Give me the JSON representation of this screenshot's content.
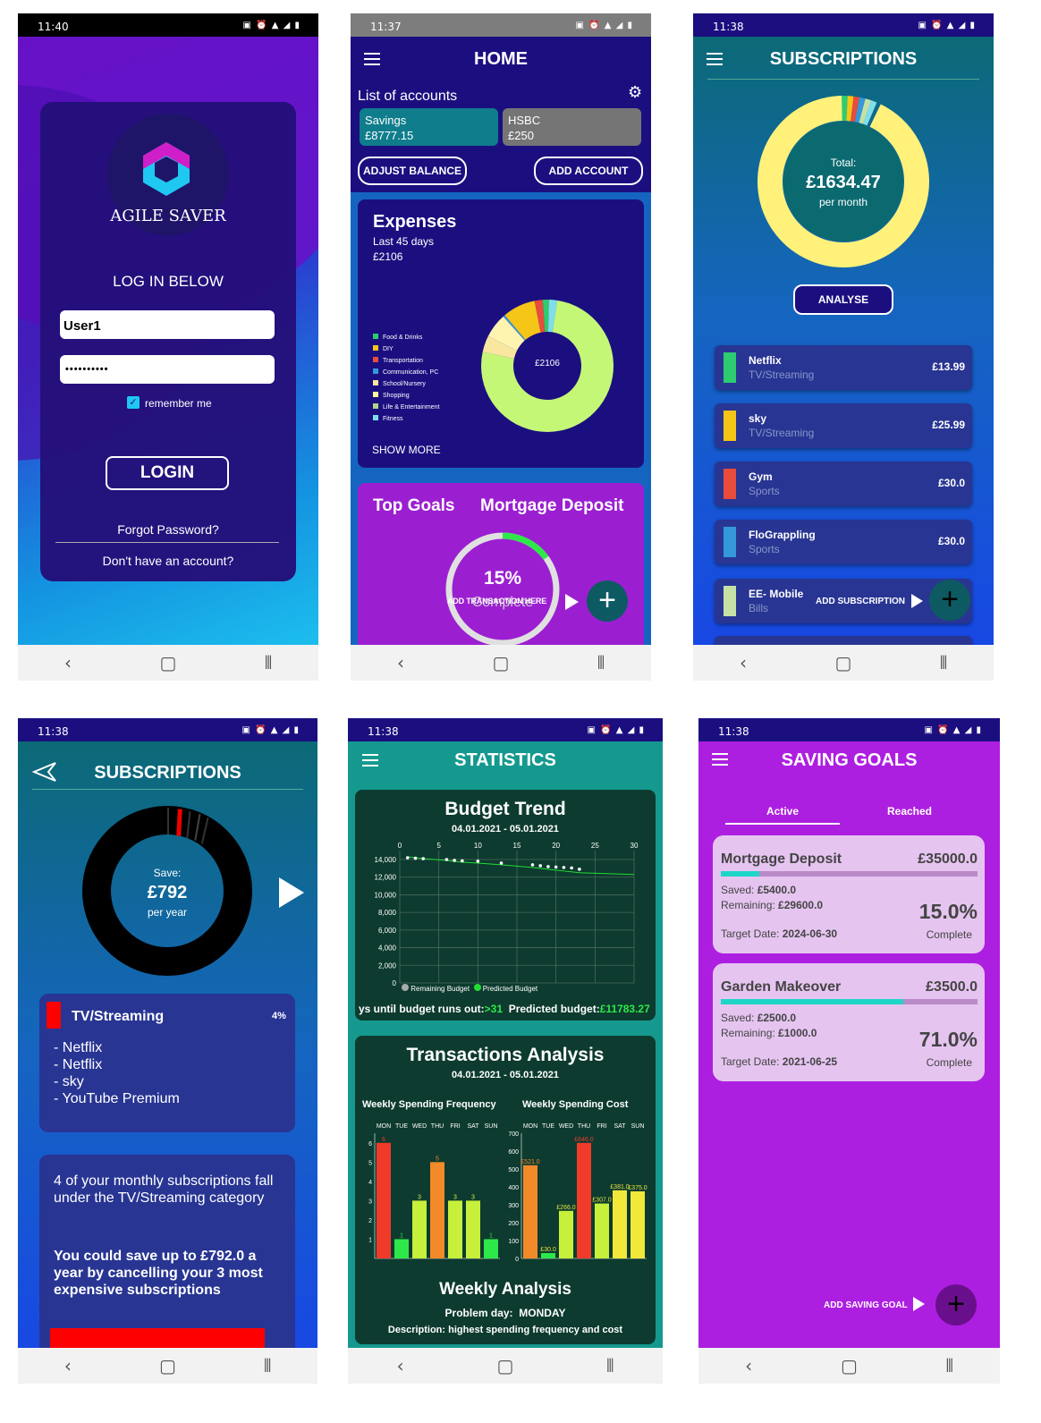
{
  "login": {
    "time": "11:40",
    "title": "AGILE SAVER",
    "subtitle": "LOG IN BELOW",
    "username": "User1",
    "password": "••••••••••",
    "remember": "remember me",
    "login_btn": "LOGIN",
    "forgot": "Forgot Password?",
    "signup": "Don't have an account?"
  },
  "home": {
    "time": "11:37",
    "title": "HOME",
    "accounts_label": "List of accounts",
    "accounts": [
      {
        "name": "Savings",
        "balance": "£8777.15"
      },
      {
        "name": "HSBC",
        "balance": "£250"
      }
    ],
    "adjust_btn": "ADJUST BALANCE",
    "add_account_btn": "ADD ACCOUNT",
    "expenses": {
      "title": "Expenses",
      "period": "Last 45 days",
      "total": "£2106",
      "center": "£2106",
      "legend": [
        "Food & Drinks",
        "DIY",
        "Transportation",
        "Communication, PC",
        "School/Nursery",
        "Shopping",
        "Life & Entertainment",
        "Fitness"
      ],
      "legend_colors": [
        "#2ecc71",
        "#f5c518",
        "#e74c3c",
        "#3498db",
        "#f9e79f",
        "#fff59d",
        "#aed581",
        "#80deea"
      ],
      "show_more": "SHOW MORE"
    },
    "goals": {
      "title": "Top Goals",
      "goal": "Mortgage Deposit",
      "percent": "15%",
      "complete": "Complete",
      "add_tx": "ADD TRANSACTION HERE",
      "progress": 0.15
    }
  },
  "subs": {
    "time": "11:38",
    "title": "SUBSCRIPTIONS",
    "total_label": "Total:",
    "total": "£1634.47",
    "per": "per month",
    "analyse_btn": "ANALYSE",
    "items": [
      {
        "name": "Netflix",
        "cat": "TV/Streaming",
        "price": "£13.99",
        "color": "#2ecc71"
      },
      {
        "name": "sky",
        "cat": "TV/Streaming",
        "price": "£25.99",
        "color": "#f5c518"
      },
      {
        "name": "Gym",
        "cat": "Sports",
        "price": "£30.0",
        "color": "#e74c3c"
      },
      {
        "name": "FloGrappling",
        "cat": "Sports",
        "price": "£30.0",
        "color": "#3498db"
      },
      {
        "name": "EE- Mobile",
        "cat": "Bills",
        "price": "",
        "color": "#c5e1a5"
      }
    ],
    "add_sub": "ADD SUBSCRIPTION"
  },
  "analyse": {
    "time": "11:38",
    "title": "SUBSCRIPTIONS",
    "save_label": "Save:",
    "save": "£792",
    "per": "per year",
    "category": "TV/Streaming",
    "percent": "4%",
    "list": [
      "- Netflix",
      "- Netflix",
      "- sky",
      "- YouTube Premium"
    ],
    "info": "4 of your monthly subscriptions fall under the TV/Streaming category",
    "tip": "You could save up to £792.0 a year by cancelling your 3 most expensive subscriptions"
  },
  "stats": {
    "time": "11:38",
    "title": "STATISTICS",
    "trend_title": "Budget Trend",
    "date_range": "04.01.2021 - 05.01.2021",
    "x_ticks": [
      "0",
      "5",
      "10",
      "15",
      "20",
      "25",
      "30"
    ],
    "y_ticks": [
      "14,000",
      "12,000",
      "10,000",
      "8,000",
      "6,000",
      "4,000",
      "2,000",
      "0"
    ],
    "legend_remaining": "Remaining Budget",
    "legend_predicted": "Predicted Budget",
    "days_label": "ys until budget runs out:",
    "days_value": ">31",
    "predicted_label": "Predicted budget:",
    "predicted_value": "£11783.27",
    "tx_title": "Transactions Analysis",
    "freq_title": "Weekly Spending Frequency",
    "cost_title": "Weekly Spending Cost",
    "days": [
      "MON",
      "TUE",
      "WED",
      "THU",
      "FRI",
      "SAT",
      "SUN"
    ],
    "freq_y": [
      "6",
      "5",
      "4",
      "3",
      "2",
      "1"
    ],
    "cost_y": [
      "700",
      "600",
      "500",
      "400",
      "300",
      "200",
      "100",
      "0"
    ],
    "weekly_title": "Weekly Analysis",
    "problem_label": "Problem day:",
    "problem_day": "MONDAY",
    "description": "Description: highest spending frequency and cost"
  },
  "goals": {
    "time": "11:38",
    "title": "SAVING GOALS",
    "tab_active": "Active",
    "tab_reached": "Reached",
    "items": [
      {
        "name": "Mortgage Deposit",
        "target": "£35000.0",
        "saved": "£5400.0",
        "remaining": "£29600.0",
        "percent": "15.0%",
        "date": "2024-06-30",
        "progress": 0.15
      },
      {
        "name": "Garden Makeover",
        "target": "£3500.0",
        "saved": "£2500.0",
        "remaining": "£1000.0",
        "percent": "71.0%",
        "date": "2021-06-25",
        "progress": 0.71
      }
    ],
    "saved_label": "Saved:",
    "remaining_label": "Remaining:",
    "target_label": "Target Date:",
    "complete": "Complete",
    "add_goal": "ADD SAVING GOAL"
  },
  "chart_data": [
    {
      "type": "pie",
      "title": "Expenses",
      "categories": [
        "Food & Drinks",
        "DIY",
        "Transportation",
        "Communication, PC",
        "School/Nursery",
        "Shopping",
        "Life & Entertainment",
        "Fitness"
      ],
      "values": [
        1.5,
        8,
        2,
        0.5,
        4,
        6,
        76,
        2
      ]
    },
    {
      "type": "line",
      "title": "Budget Trend",
      "x": [
        1,
        2,
        3,
        6,
        7,
        8,
        10,
        13,
        17,
        18,
        19,
        20,
        21,
        22,
        23
      ],
      "series": [
        {
          "name": "Remaining Budget",
          "values": [
            14200,
            14150,
            14100,
            14000,
            13900,
            13850,
            13800,
            13600,
            13400,
            13300,
            13200,
            13150,
            13100,
            13050,
            12900
          ]
        },
        {
          "name": "Predicted Budget",
          "values": [
            14300,
            14200,
            14100,
            13900,
            13800,
            13700,
            13600,
            13400,
            13100,
            13000,
            12900,
            12800,
            12700,
            12600,
            12500
          ]
        }
      ],
      "xlim": [
        0,
        30
      ],
      "ylim": [
        0,
        14000
      ]
    },
    {
      "type": "bar",
      "title": "Weekly Spending Frequency",
      "categories": [
        "MON",
        "TUE",
        "WED",
        "THU",
        "FRI",
        "SAT",
        "SUN"
      ],
      "values": [
        6,
        1,
        3,
        5,
        3,
        3,
        1
      ],
      "ylim": [
        0,
        6.5
      ]
    },
    {
      "type": "bar",
      "title": "Weekly Spending Cost",
      "categories": [
        "MON",
        "TUE",
        "WED",
        "THU",
        "FRI",
        "SAT",
        "SUN"
      ],
      "values": [
        521.0,
        30.0,
        266.0,
        646.0,
        307.0,
        381.0,
        375.0
      ],
      "labels": [
        "£521.0",
        "£30.0",
        "£266.0",
        "£646.0",
        "£307.0",
        "£381.0",
        "£375.0"
      ],
      "ylim": [
        0,
        700
      ]
    }
  ]
}
